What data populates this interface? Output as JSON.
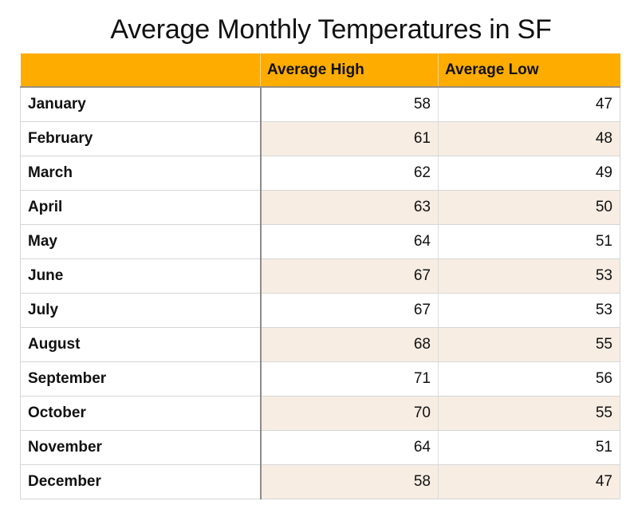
{
  "title": "Average Monthly Temperatures in SF",
  "colors": {
    "header": "#FEAC00",
    "alt_row": "#F7EDE3"
  },
  "table": {
    "headers": [
      "",
      "Average High",
      "Average Low"
    ],
    "rows": [
      {
        "month": "January",
        "high": "58",
        "low": "47"
      },
      {
        "month": "February",
        "high": "61",
        "low": "48"
      },
      {
        "month": "March",
        "high": "62",
        "low": "49"
      },
      {
        "month": "April",
        "high": "63",
        "low": "50"
      },
      {
        "month": "May",
        "high": "64",
        "low": "51"
      },
      {
        "month": "June",
        "high": "67",
        "low": "53"
      },
      {
        "month": "July",
        "high": "67",
        "low": "53"
      },
      {
        "month": "August",
        "high": "68",
        "low": "55"
      },
      {
        "month": "September",
        "high": "71",
        "low": "56"
      },
      {
        "month": "October",
        "high": "70",
        "low": "55"
      },
      {
        "month": "November",
        "high": "64",
        "low": "51"
      },
      {
        "month": "December",
        "high": "58",
        "low": "47"
      }
    ]
  }
}
